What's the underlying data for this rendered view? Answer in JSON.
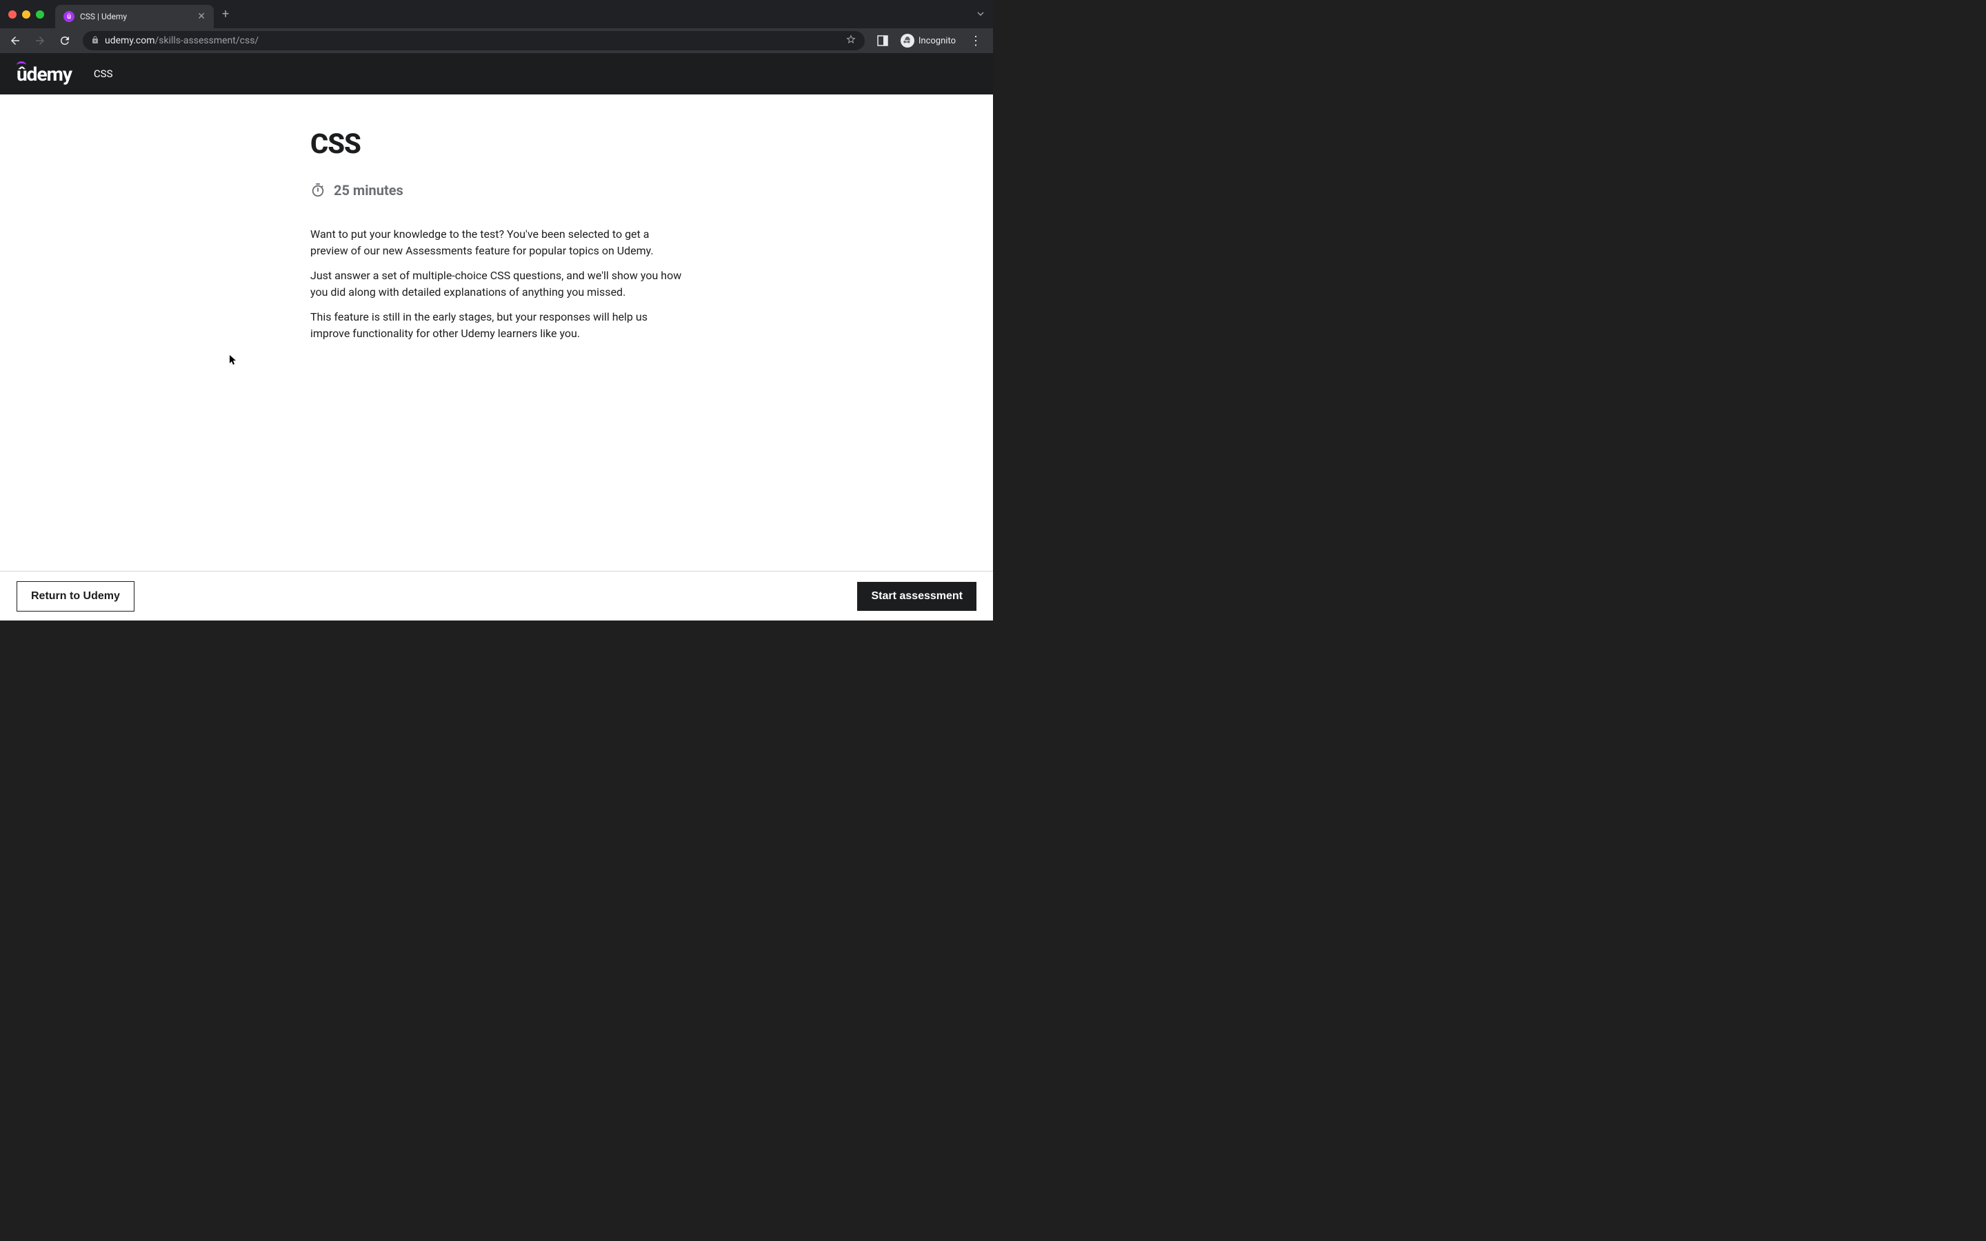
{
  "browser": {
    "tab_title": "CSS | Udemy",
    "url_domain": "udemy.com",
    "url_path": "/skills-assessment/css/",
    "incognito_label": "Incognito"
  },
  "header": {
    "logo_text": "ûdemy",
    "breadcrumb": "CSS"
  },
  "main": {
    "title": "CSS",
    "duration": "25 minutes",
    "paragraphs": [
      "Want to put your knowledge to the test? You've been selected to get a preview of our new Assessments feature for popular topics on Udemy.",
      "Just answer a set of multiple-choice CSS questions, and we'll show you how you did along with detailed explanations of anything you missed.",
      "This feature is still in the early stages, but your responses will help us improve functionality for other Udemy learners like you."
    ]
  },
  "footer": {
    "return_label": "Return to Udemy",
    "start_label": "Start assessment"
  }
}
